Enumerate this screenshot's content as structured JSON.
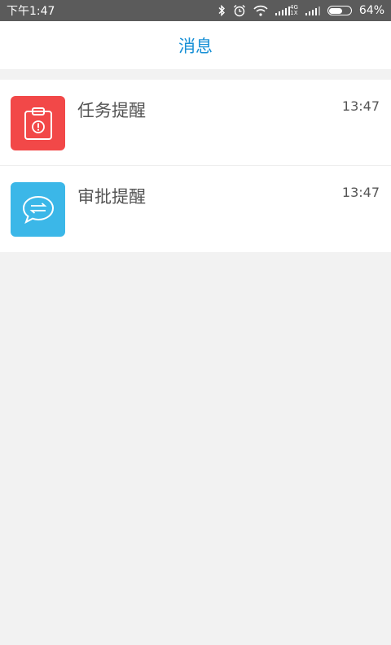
{
  "status_bar": {
    "time": "下午1:47",
    "network_top": "4G",
    "network_bottom": "1X",
    "battery_percent": "64%",
    "battery_level": 0.64,
    "icons": [
      "bluetooth-icon",
      "alarm-icon",
      "wifi-icon",
      "signal-icon",
      "signal-icon",
      "battery-icon"
    ]
  },
  "header": {
    "title": "消息",
    "title_color": "#1890d6"
  },
  "messages": [
    {
      "title": "任务提醒",
      "time": "13:47",
      "icon": "clipboard-alert-icon",
      "icon_color": "#f24848"
    },
    {
      "title": "审批提醒",
      "time": "13:47",
      "icon": "chat-transfer-icon",
      "icon_color": "#3bb7e8"
    }
  ]
}
